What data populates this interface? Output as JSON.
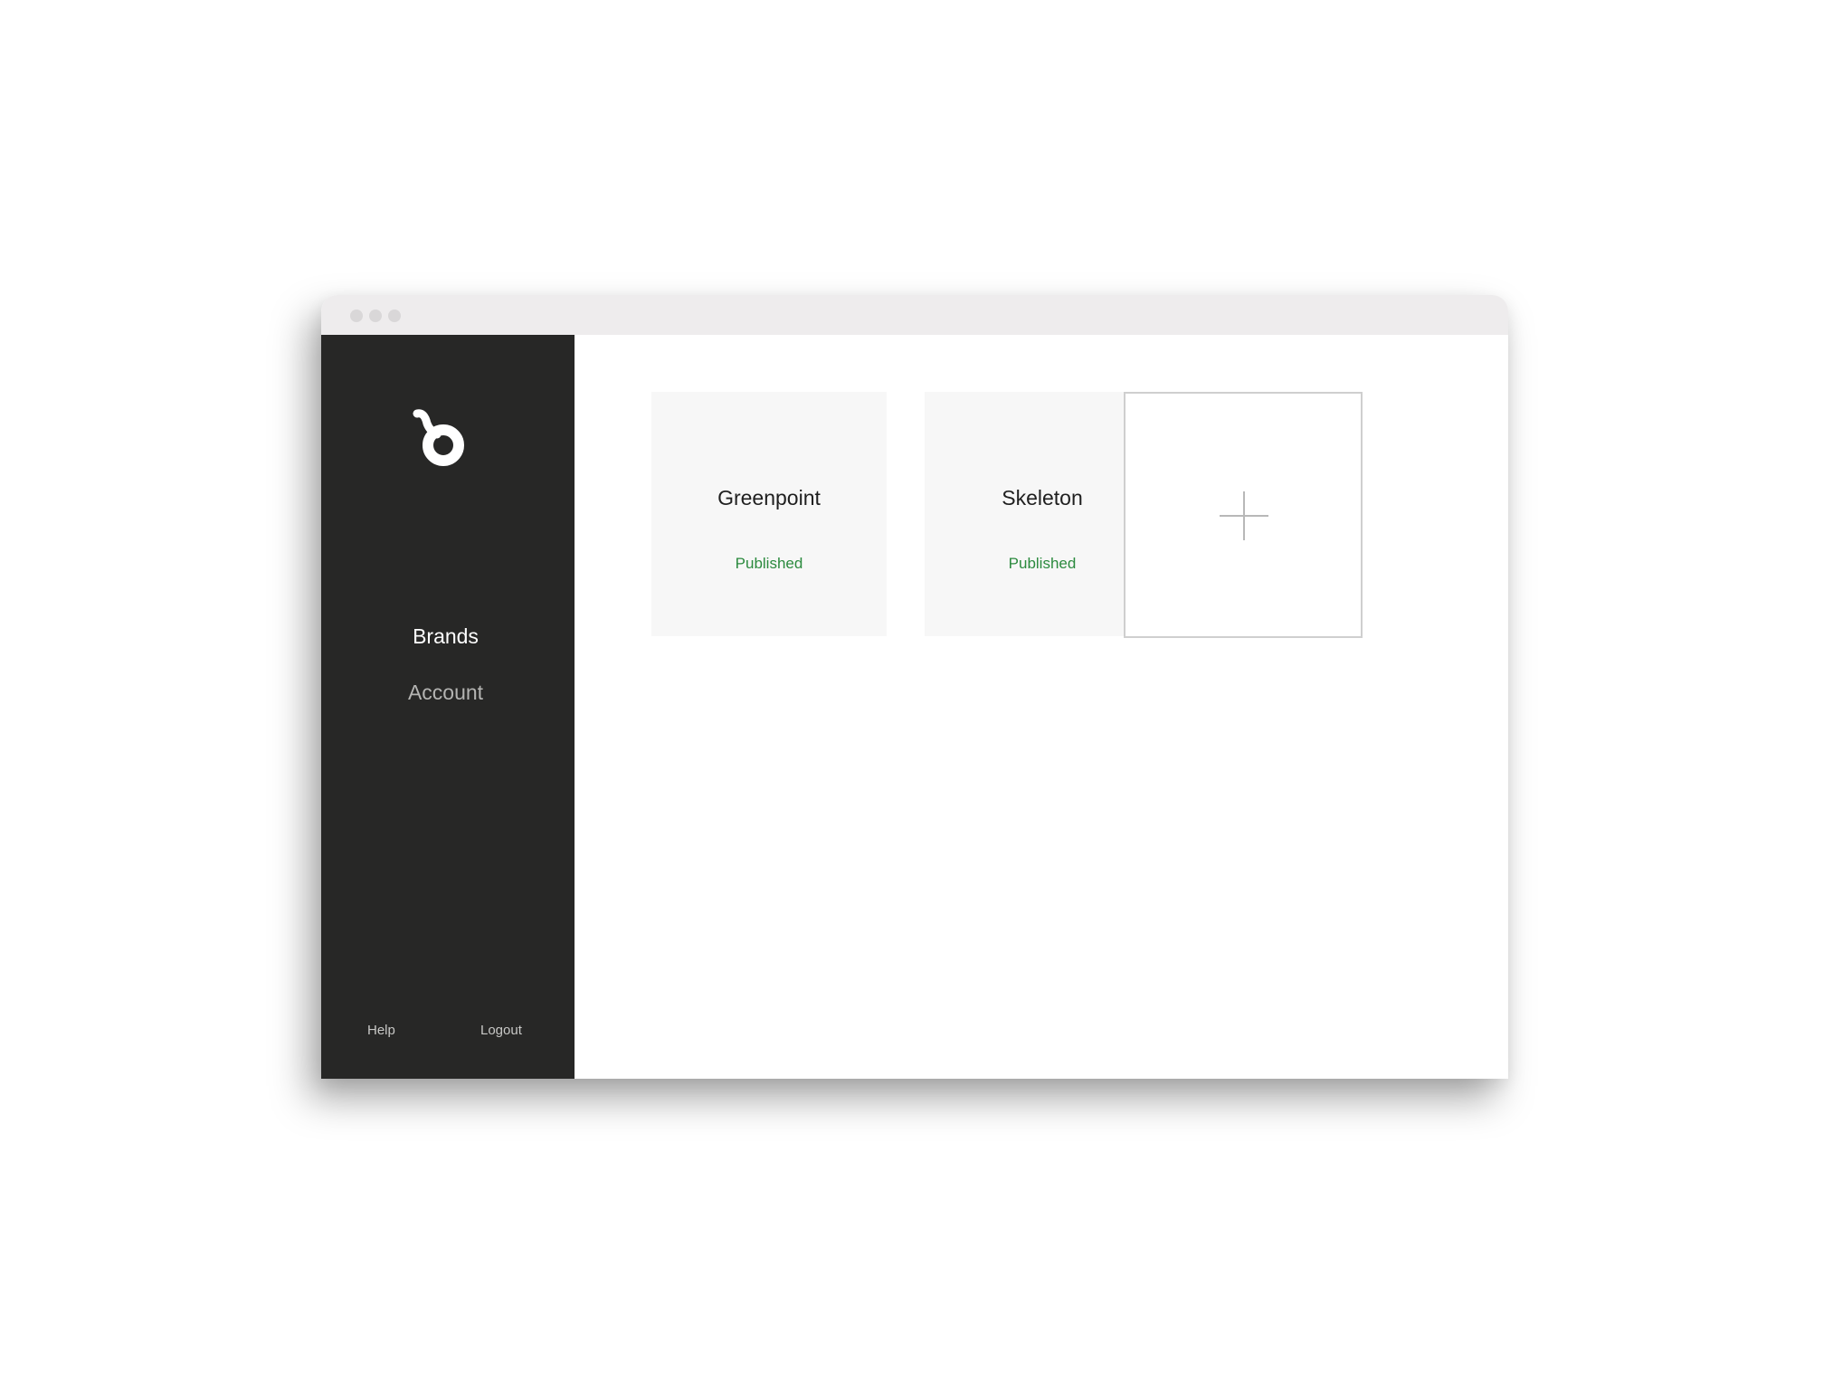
{
  "sidebar": {
    "logo": "brand-b-logo-icon",
    "nav": [
      {
        "label": "Brands",
        "active": true
      },
      {
        "label": "Account",
        "active": false
      }
    ],
    "footer": {
      "help": "Help",
      "logout": "Logout"
    }
  },
  "brands": [
    {
      "name": "Greenpoint",
      "status": "Published"
    },
    {
      "name": "Skeleton",
      "status": "Published"
    }
  ],
  "add_brand": {
    "icon": "plus-icon"
  },
  "colors": {
    "sidebar_bg": "#272726",
    "status_published": "#2b8a3e",
    "card_bg": "#f7f7f7"
  }
}
